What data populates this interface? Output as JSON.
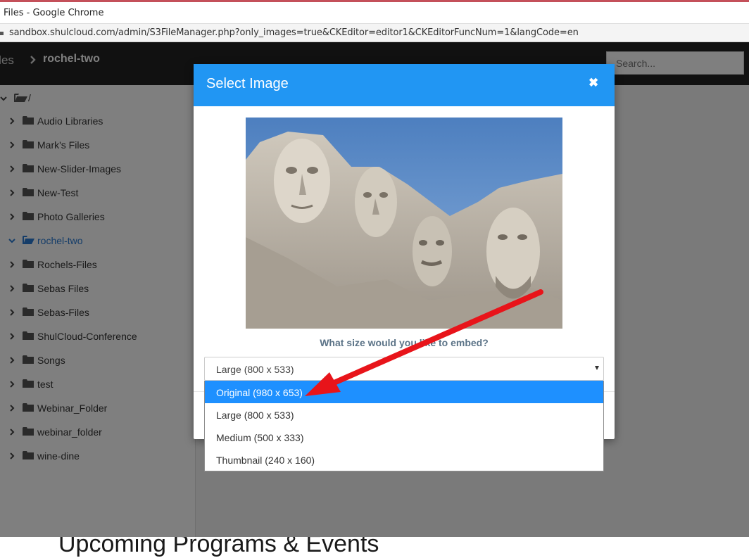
{
  "window": {
    "title": "Files - Google Chrome",
    "url": "sandbox.shulcloud.com/admin/S3FileManager.php?only_images=true&CKEditor=editor1&CKEditorFuncNum=1&langCode=en"
  },
  "nav": {
    "breadcrumb_root": "Files",
    "breadcrumb_current": "rochel-two",
    "search_placeholder": "Search..."
  },
  "tree": {
    "root_label": "/",
    "items": [
      {
        "label": "Audio Libraries",
        "expanded": false
      },
      {
        "label": "Mark's Files",
        "expanded": false
      },
      {
        "label": "New-Slider-Images",
        "expanded": false
      },
      {
        "label": "New-Test",
        "expanded": false
      },
      {
        "label": "Photo Galleries",
        "expanded": false
      },
      {
        "label": "rochel-two",
        "expanded": true,
        "active": true
      },
      {
        "label": "Rochels-Files",
        "expanded": false
      },
      {
        "label": "Sebas Files",
        "expanded": false
      },
      {
        "label": "Sebas-Files",
        "expanded": false
      },
      {
        "label": "ShulCloud-Conference",
        "expanded": false
      },
      {
        "label": "Songs",
        "expanded": false
      },
      {
        "label": "test",
        "expanded": false
      },
      {
        "label": "Webinar_Folder",
        "expanded": false
      },
      {
        "label": "webinar_folder",
        "expanded": false
      },
      {
        "label": "wine-dine",
        "expanded": false
      }
    ]
  },
  "modal": {
    "title": "Select Image",
    "close_icon": "close-icon",
    "question": "What size would you like to embed?",
    "select_value": "Large (800 x 533)",
    "options": [
      {
        "label": "Original (980 x 653)",
        "highlighted": true
      },
      {
        "label": "Large (800 x 533)",
        "highlighted": false
      },
      {
        "label": "Medium (500 x 333)",
        "highlighted": false
      },
      {
        "label": "Thumbnail (240 x 160)",
        "highlighted": false
      }
    ]
  },
  "background": {
    "heading": "Upcoming Programs & Events"
  },
  "colors": {
    "modal_header": "#2196f3",
    "highlight": "#1e90ff",
    "active_folder": "#2a7ad3",
    "annotation_arrow": "#e8141a"
  }
}
